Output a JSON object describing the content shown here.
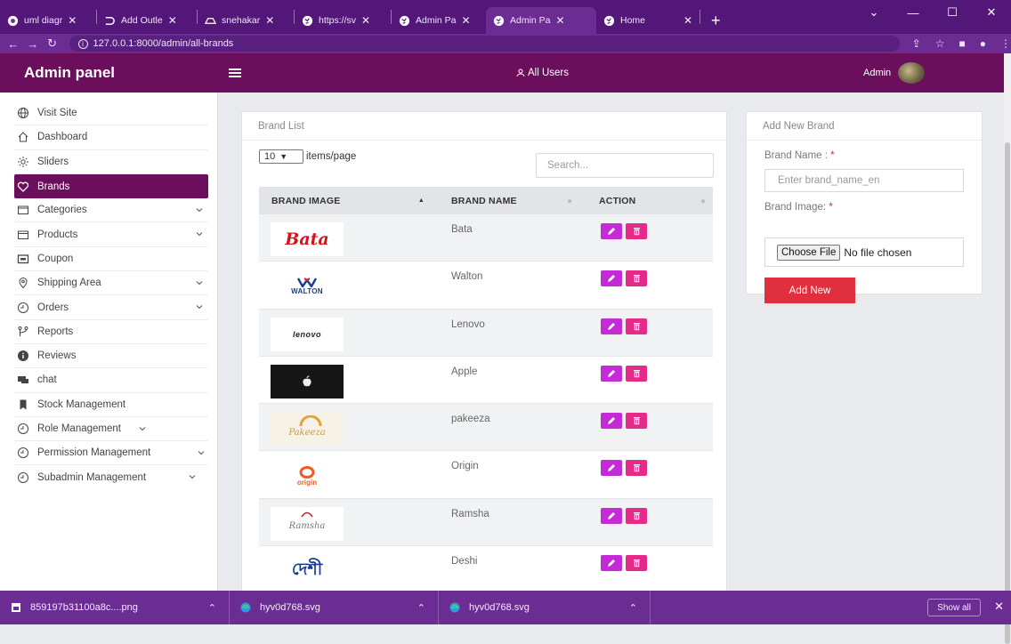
{
  "browser": {
    "tabs": [
      {
        "label": "uml diagr",
        "icon": "chrome-icon",
        "active": false
      },
      {
        "label": "Add Outle",
        "icon": "dchat-icon",
        "active": false
      },
      {
        "label": "snehakar",
        "icon": "drive-icon",
        "active": false
      },
      {
        "label": "https://sv",
        "icon": "globe-icon",
        "active": false
      },
      {
        "label": "Admin Pa",
        "icon": "globe-icon",
        "active": false
      },
      {
        "label": "Admin Pa",
        "icon": "globe-icon",
        "active": true
      },
      {
        "label": "Home",
        "icon": "globe-icon",
        "active": false
      }
    ],
    "url": "127.0.0.1:8000/admin/all-brands"
  },
  "header": {
    "app_title": "Admin panel",
    "all_users": "All Users",
    "admin_label": "Admin"
  },
  "sidebar": {
    "items": [
      {
        "label": "Visit Site",
        "icon": "globe-icon",
        "dropdown": false
      },
      {
        "label": "Dashboard",
        "icon": "home-icon",
        "dropdown": false
      },
      {
        "label": "Sliders",
        "icon": "slider-icon",
        "dropdown": false
      },
      {
        "label": "Brands",
        "icon": "heart-icon",
        "dropdown": false,
        "active": true
      },
      {
        "label": "Categories",
        "icon": "folder-icon",
        "dropdown": true
      },
      {
        "label": "Products",
        "icon": "box-icon",
        "dropdown": true
      },
      {
        "label": "Coupon",
        "icon": "ticket-icon",
        "dropdown": false
      },
      {
        "label": "Shipping Area",
        "icon": "location-icon",
        "dropdown": true
      },
      {
        "label": "Orders",
        "icon": "orders-icon",
        "dropdown": true
      },
      {
        "label": "Reports",
        "icon": "reports-icon",
        "dropdown": false
      },
      {
        "label": "Reviews",
        "icon": "info-icon",
        "dropdown": false
      },
      {
        "label": "chat",
        "icon": "chat-icon",
        "dropdown": false
      },
      {
        "label": "Stock Management",
        "icon": "bookmark-icon",
        "dropdown": false
      },
      {
        "label": "Role Management",
        "icon": "role-icon",
        "dropdown": true
      },
      {
        "label": "Permission Management",
        "icon": "role-icon",
        "dropdown": true
      },
      {
        "label": "Subadmin Management",
        "icon": "role-icon",
        "dropdown": true
      }
    ]
  },
  "brand_list": {
    "title": "Brand List",
    "page_size": "10",
    "items_per_page_label": "items/page",
    "search_placeholder": "Search...",
    "columns": [
      "BRAND IMAGE",
      "BRAND NAME",
      "ACTION"
    ],
    "rows": [
      {
        "name": "Bata",
        "logo": "bata-logo"
      },
      {
        "name": "Walton",
        "logo": "walton-logo"
      },
      {
        "name": "Lenovo",
        "logo": "lenovo-logo"
      },
      {
        "name": "Apple",
        "logo": "apple-logo"
      },
      {
        "name": "pakeeza",
        "logo": "pakeeza-logo"
      },
      {
        "name": "Origin",
        "logo": "origin-logo"
      },
      {
        "name": "Ramsha",
        "logo": "ramsha-logo"
      },
      {
        "name": "Deshi",
        "logo": "deshi-logo"
      }
    ],
    "logo_text": {
      "bata": "Bata",
      "walton": "WALTON",
      "lenovo": "lenovo",
      "origin": "origin",
      "pakeeza": "Pakeeza",
      "ramsha": "Ramsha",
      "deshi": "দেশী"
    }
  },
  "add_brand": {
    "title": "Add New Brand",
    "name_label": "Brand Name :",
    "name_placeholder": "Enter brand_name_en",
    "image_label": "Brand Image:",
    "required_mark": "*",
    "choose_file": "Choose File",
    "no_file": "No file chosen",
    "submit": "Add New"
  },
  "downloads": {
    "items": [
      {
        "label": "859197b31100a8c....png",
        "icon": "image-file-icon"
      },
      {
        "label": "hyv0d768.svg",
        "icon": "edge-icon"
      },
      {
        "label": "hyv0d768.svg",
        "icon": "edge-icon"
      }
    ],
    "show_all": "Show all"
  },
  "colors": {
    "brand_primary": "#6b0e5c",
    "browser_chrome": "#6b2c93",
    "edit_button": "#c42bd6",
    "delete_button": "#e62a8a",
    "add_button": "#e0303e",
    "required": "#e8204b"
  }
}
